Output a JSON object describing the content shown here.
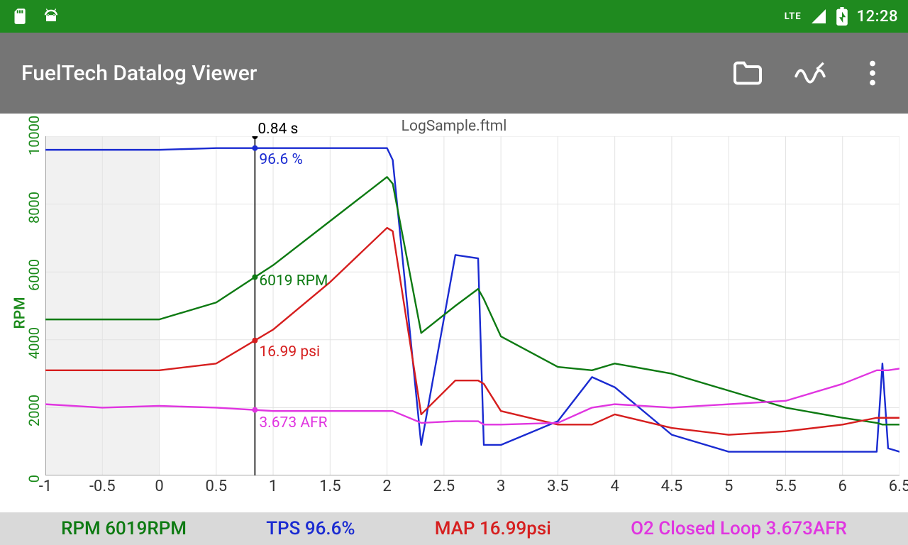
{
  "status_bar": {
    "clock": "12:28",
    "lte_label": "LTE",
    "icons": [
      "sd-card",
      "android-head",
      "lte",
      "signal",
      "battery-charging"
    ]
  },
  "toolbar": {
    "title": "FuelTech Datalog Viewer",
    "actions": {
      "open": "open-folder",
      "chart_settings": "chart-settings",
      "overflow": "more"
    }
  },
  "chart_data": {
    "type": "line",
    "title": "LogSample.ftml",
    "xlabel": "",
    "ylabel": "RPM",
    "x": [
      -1,
      -0.5,
      0,
      0.5,
      1,
      1.5,
      2,
      2.05,
      2.3,
      2.6,
      2.8,
      2.85,
      3,
      3.5,
      3.8,
      4,
      4.5,
      5,
      5.5,
      6,
      6.3,
      6.35,
      6.4,
      6.5
    ],
    "xlim": [
      -1,
      6.5
    ],
    "ylim": [
      0,
      10000
    ],
    "xticks": [
      -1,
      -0.5,
      0,
      0.5,
      1,
      1.5,
      2,
      2.5,
      3,
      3.5,
      4,
      4.5,
      5,
      5.5,
      6,
      6.5
    ],
    "yticks": [
      0,
      2000,
      4000,
      6000,
      8000,
      10000
    ],
    "cursor": {
      "x": 0.84,
      "label": "0.84 s",
      "readings": {
        "tps": {
          "text": "96.6 %",
          "color": "#1a2bd1"
        },
        "rpm": {
          "text": "6019 RPM",
          "color": "#0d7a12"
        },
        "map": {
          "text": "16.99 psi",
          "color": "#d61e1e"
        },
        "afr": {
          "text": "3.673 AFR",
          "color": "#e035e0"
        }
      }
    },
    "series": [
      {
        "name": "TPS",
        "color": "#1a2bd1",
        "values": [
          9600,
          9600,
          9600,
          9650,
          9650,
          9650,
          9650,
          9300,
          900,
          6500,
          6400,
          900,
          900,
          1600,
          2900,
          2600,
          1200,
          700,
          700,
          700,
          700,
          3300,
          800,
          700
        ]
      },
      {
        "name": "RPM",
        "color": "#0d7a12",
        "values": [
          4600,
          4600,
          4600,
          5100,
          6200,
          7500,
          8800,
          8600,
          4200,
          5000,
          5500,
          5200,
          4100,
          3200,
          3100,
          3300,
          3000,
          2500,
          2000,
          1700,
          1550,
          1500,
          1500,
          1500
        ]
      },
      {
        "name": "MAP",
        "color": "#d61e1e",
        "values": [
          3100,
          3100,
          3100,
          3300,
          4300,
          5700,
          7300,
          7200,
          1800,
          2800,
          2800,
          2700,
          1900,
          1500,
          1500,
          1800,
          1400,
          1200,
          1300,
          1500,
          1700,
          1700,
          1700,
          1700
        ]
      },
      {
        "name": "O2 Closed Loop",
        "color": "#e035e0",
        "values": [
          2100,
          2000,
          2050,
          2000,
          1900,
          1900,
          1900,
          1900,
          1550,
          1600,
          1600,
          1500,
          1500,
          1550,
          2000,
          2100,
          2000,
          2100,
          2200,
          2700,
          3100,
          3100,
          3100,
          3150
        ]
      }
    ]
  },
  "readout": {
    "rpm": {
      "label": "RPM 6019RPM",
      "color": "#0d7a12"
    },
    "tps": {
      "label": "TPS 96.6%",
      "color": "#1a2bd1"
    },
    "map": {
      "label": "MAP 16.99psi",
      "color": "#d61e1e"
    },
    "afr": {
      "label": "O2 Closed Loop 3.673AFR",
      "color": "#e035e0"
    }
  }
}
